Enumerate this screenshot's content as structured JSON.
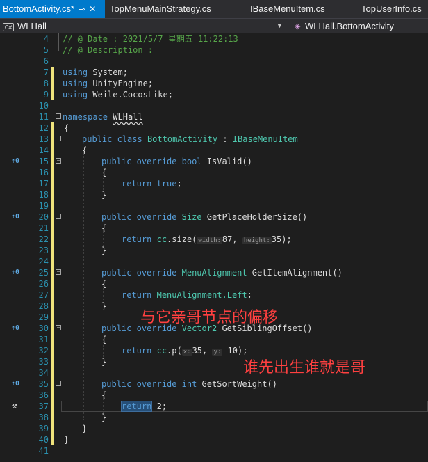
{
  "tabs": [
    {
      "label": "BottomActivity.cs*",
      "active": true
    },
    {
      "label": "TopMenuMainStrategy.cs",
      "active": false
    },
    {
      "label": "IBaseMenuItem.cs",
      "active": false
    },
    {
      "label": "TopUserInfo.cs",
      "active": false
    }
  ],
  "nav": {
    "project": "WLHall",
    "class_path": "WLHall.BottomActivity",
    "file_icon": "C#"
  },
  "code": {
    "l4": "// @ Date : 2021/5/7 星期五 11:22:13",
    "l5": "// @ Description :",
    "using": "using",
    "ns_system": "System",
    "ns_unity": "UnityEngine",
    "ns_weile": "Weile.CocosLike",
    "namespace_kw": "namespace",
    "namespace_name": "WLHall",
    "public": "public",
    "class": "class",
    "class_name": "BottomActivity",
    "interface": "IBaseMenuItem",
    "override": "override",
    "bool": "bool",
    "m1": "IsValid()",
    "return": "return",
    "true": "true",
    "size_type": "Size",
    "m2": "GetPlaceHolderSize()",
    "cc": "cc",
    "size_call": "size(",
    "hint_width": "width:",
    "v87": "87",
    "hint_height": "height:",
    "v35": "35",
    "align_type": "MenuAlignment",
    "m3": "GetItemAlignment()",
    "align_left": "MenuAlignment.Left",
    "vec_type": "Vector2",
    "m4": "GetSiblingOffset()",
    "p_call": "p(",
    "hint_x": "x:",
    "hint_y": "y:",
    "vneg10": "-10",
    "int_kw": "int",
    "m5": "GetSortWeight()",
    "v2": "2"
  },
  "line_numbers": [
    "4",
    "5",
    "6",
    "7",
    "8",
    "9",
    "10",
    "11",
    "12",
    "13",
    "14",
    "15",
    "16",
    "17",
    "18",
    "19",
    "20",
    "21",
    "22",
    "23",
    "24",
    "25",
    "26",
    "27",
    "28",
    "29",
    "30",
    "31",
    "32",
    "33",
    "34",
    "35",
    "36",
    "37",
    "38",
    "39",
    "40",
    "41"
  ],
  "refs": {
    "count": "0"
  },
  "annotations": {
    "a1": "与它亲哥节点的偏移",
    "a2": "谁先出生谁就是哥"
  }
}
